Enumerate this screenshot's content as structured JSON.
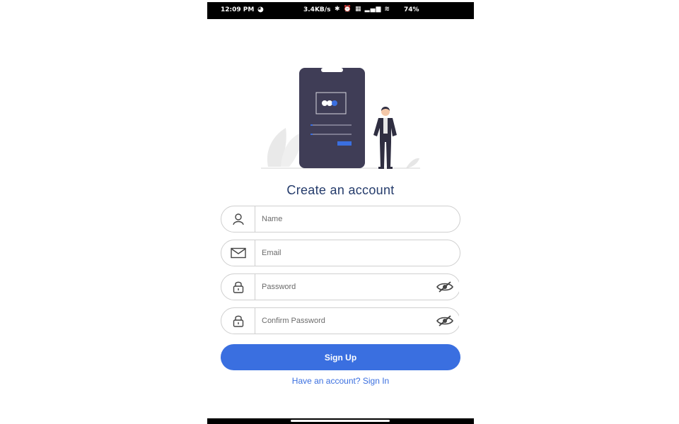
{
  "status_bar": {
    "time": "12:09 PM",
    "net_speed": "3.4KB/s",
    "system_icons": "✱ ⏰ ▦ ▂▄▆ ≋",
    "battery": "74%"
  },
  "title": "Create an account",
  "form": {
    "name_placeholder": "Name",
    "email_placeholder": "Email",
    "password_placeholder": "Password",
    "confirm_password_placeholder": "Confirm Password"
  },
  "signup_label": "Sign Up",
  "signin_link": "Have an account? Sign In",
  "icons": {
    "name": "user-icon",
    "email": "mail-icon",
    "password": "lock-icon",
    "visibility": "eye-off-icon"
  },
  "colors": {
    "primary": "#3a6fe0",
    "title": "#243b6b",
    "phone_illustration": "#3f3d56"
  }
}
